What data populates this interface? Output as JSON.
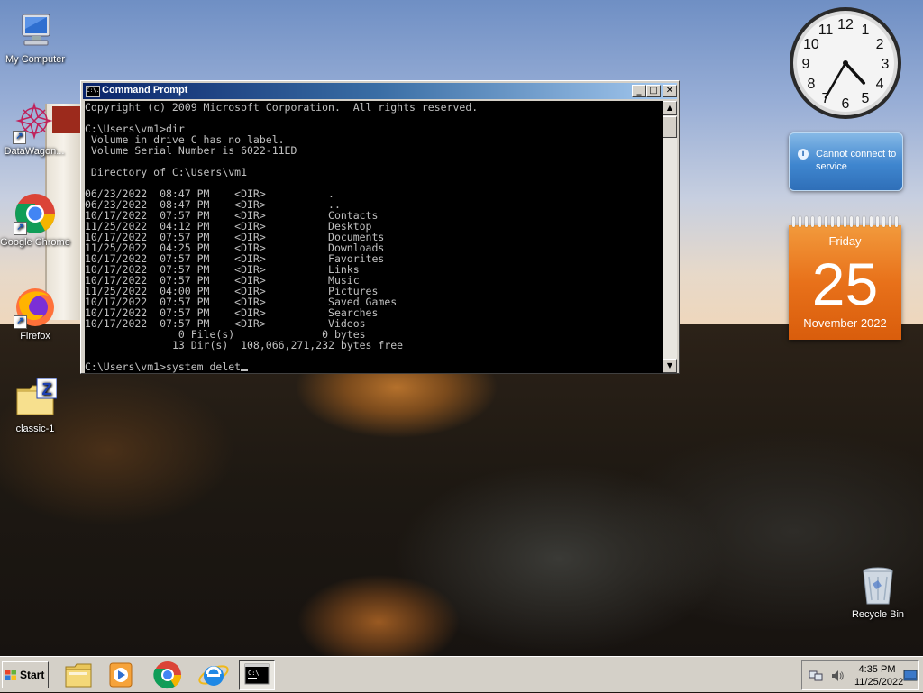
{
  "desktop": {
    "icons": [
      {
        "label": "My Computer"
      },
      {
        "label": "DataWagon..."
      },
      {
        "label": "Google Chrome"
      },
      {
        "label": "Firefox"
      },
      {
        "label": "classic-1"
      },
      {
        "label": "Recycle Bin"
      }
    ]
  },
  "gadgets": {
    "clock": {
      "hour": 4,
      "minute": 35,
      "numbers": [
        "12",
        "1",
        "2",
        "3",
        "4",
        "5",
        "6",
        "7",
        "8",
        "9",
        "10",
        "11"
      ]
    },
    "weather": {
      "message": "Cannot connect to service"
    },
    "calendar": {
      "day": "Friday",
      "date": "25",
      "month": "November 2022"
    }
  },
  "cmd_window": {
    "title": "Command Prompt",
    "icon_text": "C:\\.",
    "minimize": "_",
    "maximize": "□",
    "close": "✕",
    "lines": [
      "Copyright (c) 2009 Microsoft Corporation.  All rights reserved.",
      "",
      "C:\\Users\\vm1>dir",
      " Volume in drive C has no label.",
      " Volume Serial Number is 6022-11ED",
      "",
      " Directory of C:\\Users\\vm1",
      "",
      "06/23/2022  08:47 PM    <DIR>          .",
      "06/23/2022  08:47 PM    <DIR>          ..",
      "10/17/2022  07:57 PM    <DIR>          Contacts",
      "11/25/2022  04:12 PM    <DIR>          Desktop",
      "10/17/2022  07:57 PM    <DIR>          Documents",
      "11/25/2022  04:25 PM    <DIR>          Downloads",
      "10/17/2022  07:57 PM    <DIR>          Favorites",
      "10/17/2022  07:57 PM    <DIR>          Links",
      "10/17/2022  07:57 PM    <DIR>          Music",
      "11/25/2022  04:00 PM    <DIR>          Pictures",
      "10/17/2022  07:57 PM    <DIR>          Saved Games",
      "10/17/2022  07:57 PM    <DIR>          Searches",
      "10/17/2022  07:57 PM    <DIR>          Videos",
      "               0 File(s)              0 bytes",
      "              13 Dir(s)  108,066,271,232 bytes free",
      ""
    ],
    "prompt_line": "C:\\Users\\vm1>system delet"
  },
  "taskbar": {
    "start_label": "Start",
    "pinned": [
      "explorer-icon",
      "media-player-icon",
      "chrome-icon",
      "internet-explorer-icon",
      "cmd-icon"
    ],
    "tray": {
      "time": "4:35 PM",
      "date": "11/25/2022"
    }
  },
  "colors": {
    "console_bg": "#000000",
    "console_fg": "#c0c0c0",
    "titlebar_start": "#0a246a",
    "titlebar_end": "#a6caf0",
    "calendar_orange": "#e8711a",
    "weather_blue": "#3f86cf"
  }
}
